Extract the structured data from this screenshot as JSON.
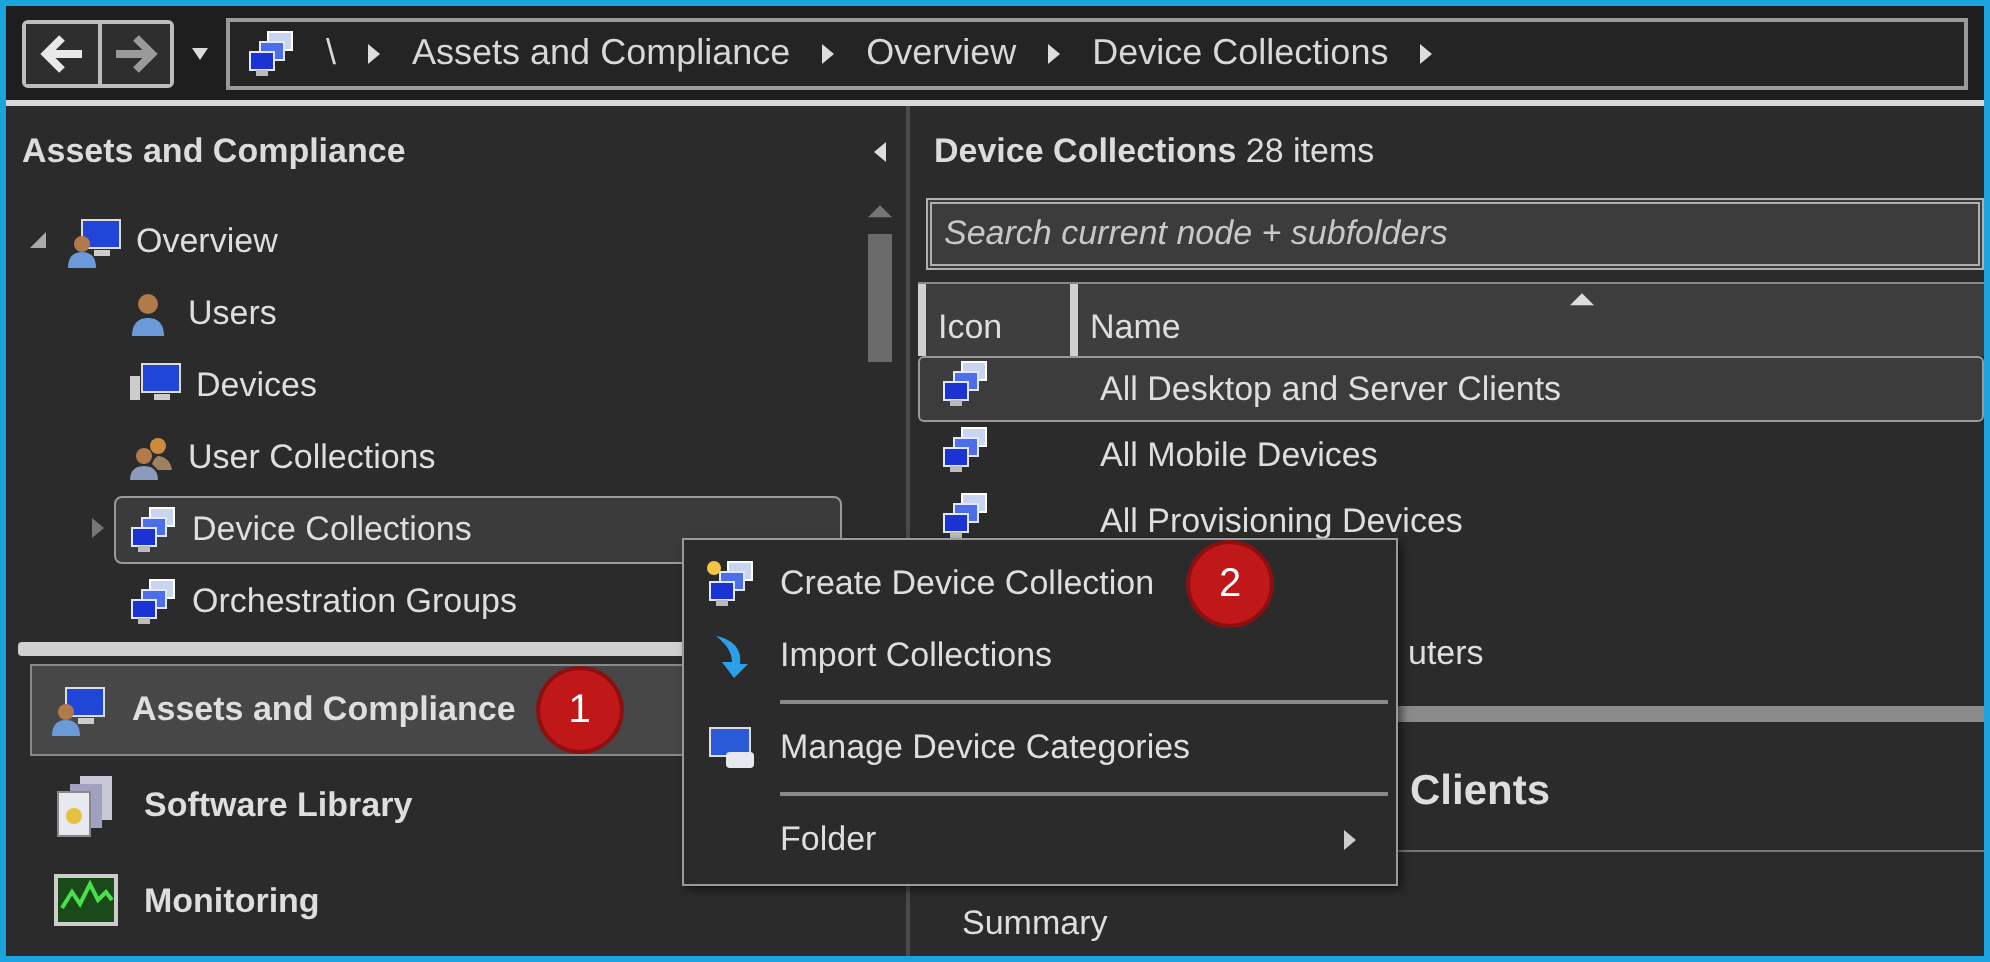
{
  "address_bar": {
    "path": [
      "\\",
      "Assets and Compliance",
      "Overview",
      "Device Collections"
    ]
  },
  "navigation_pane": {
    "title": "Assets and Compliance",
    "tree": [
      {
        "label": "Overview",
        "kind": "overview",
        "expanded": true,
        "selected": false,
        "children": [
          {
            "label": "Users",
            "kind": "user",
            "selected": false
          },
          {
            "label": "Devices",
            "kind": "device",
            "selected": false
          },
          {
            "label": "User Collections",
            "kind": "user-collection",
            "selected": false
          },
          {
            "label": "Device Collections",
            "kind": "device-collection",
            "expanded": false,
            "selected": true
          },
          {
            "label": "Orchestration Groups",
            "kind": "device-collection",
            "selected": false
          }
        ]
      }
    ],
    "workspaces": [
      {
        "label": "Assets and Compliance",
        "kind": "assets",
        "selected": true,
        "badge": "1"
      },
      {
        "label": "Software Library",
        "kind": "library",
        "selected": false
      },
      {
        "label": "Monitoring",
        "kind": "monitoring",
        "selected": false
      }
    ]
  },
  "list_pane": {
    "title": "Device Collections",
    "count": "28 items",
    "search": {
      "placeholder": "Search current node + subfolders"
    },
    "columns": [
      "Icon",
      "Name"
    ],
    "rows": [
      {
        "name": "All Desktop and Server Clients",
        "kind": "full",
        "selected": true
      },
      {
        "name": "All Mobile Devices",
        "kind": "full",
        "selected": false
      },
      {
        "name": "All Provisioning Devices",
        "kind": "full",
        "selected": false
      },
      {
        "name": "uters",
        "kind": "covered",
        "selected": false
      }
    ],
    "details": {
      "title": "Clients",
      "tab": "Summary"
    }
  },
  "context_menu": [
    {
      "kind": "item",
      "label": "Create Device Collection",
      "badge": "2"
    },
    {
      "kind": "item",
      "label": "Import Collections"
    },
    {
      "kind": "separator"
    },
    {
      "kind": "item",
      "label": "Manage Device Categories"
    },
    {
      "kind": "separator"
    },
    {
      "kind": "submenu",
      "label": "Folder"
    }
  ]
}
